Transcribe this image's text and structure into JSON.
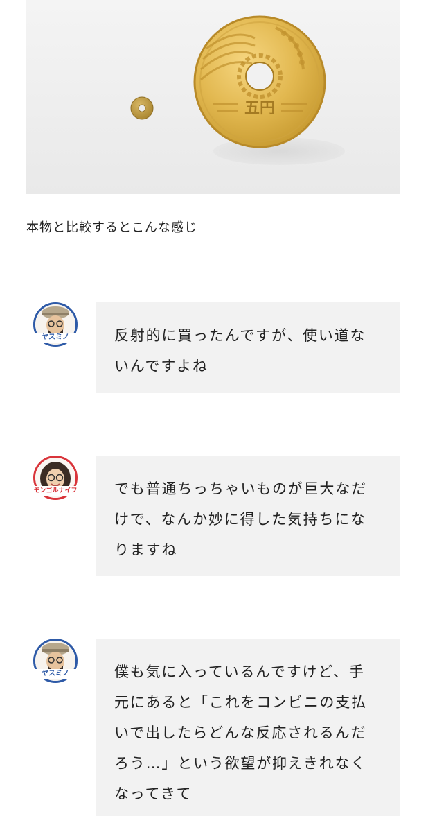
{
  "photo": {
    "caption": "本物と比較するとこんな感じ",
    "coin_label": "五円"
  },
  "messages": [
    {
      "speaker": "ヤスミノ",
      "speaker_color": "#2e5aa7",
      "lines": [
        "反射的に買ったんですが、使い道な",
        "いんですよね"
      ]
    },
    {
      "speaker": "モンゴルナイフ",
      "speaker_color": "#d9343a",
      "lines": [
        "でも普通ちっちゃいものが巨大なだ",
        "けで、なんか妙に得した気持ちにな",
        "りますね"
      ]
    },
    {
      "speaker": "ヤスミノ",
      "speaker_color": "#2e5aa7",
      "lines": [
        "僕も気に入っているんですけど、手",
        "元にあると「これをコンビニの支払",
        "いで出したらどんな反応されるんだ",
        "ろう…」という欲望が抑えきれなく",
        "なってきて"
      ]
    }
  ]
}
